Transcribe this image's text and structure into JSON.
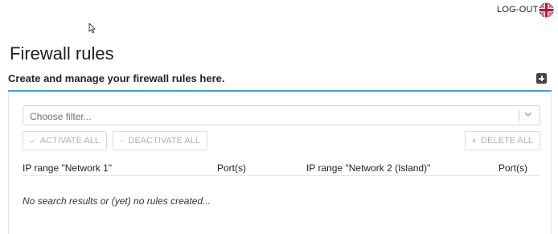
{
  "header": {
    "logout_label": "LOG-OUT",
    "language_icon": "uk-flag-icon"
  },
  "page": {
    "title": "Firewall rules",
    "subtitle": "Create and manage your firewall rules here.",
    "add_icon": "plus-icon"
  },
  "filter": {
    "placeholder": "Choose filter...",
    "dropdown_icon": "chevron-down-icon"
  },
  "actions": {
    "activate_all": "ACTIVATE ALL",
    "activate_icon": "check-icon",
    "deactivate_all": "DEACTIVATE ALL",
    "deactivate_icon": "close-icon",
    "delete_all": "DELETE ALL",
    "delete_icon": "trash-icon"
  },
  "table": {
    "columns": [
      "IP range \"Network 1\"",
      "Port(s)",
      "IP range \"Network 2 (Island)\"",
      "Port(s)"
    ],
    "empty_message": "No search results or (yet) no rules created..."
  },
  "colors": {
    "accent": "#3aa1d4",
    "disabled_text": "#b0b0b0",
    "flag_red": "#c8102e",
    "flag_blue": "#012169"
  }
}
